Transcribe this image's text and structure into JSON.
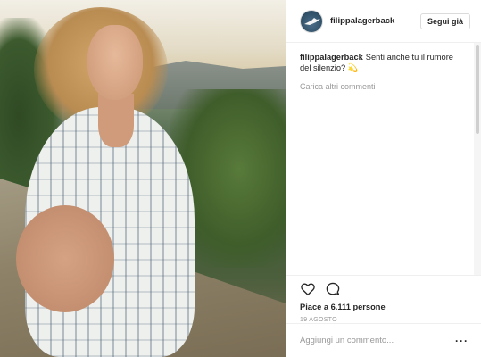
{
  "post": {
    "username": "filippalagerback",
    "follow_label": "Segui già",
    "caption_user": "filippalagerback",
    "caption_text": "Senti anche tu il rumore del silenzio? 💫",
    "load_more": "Carica altri commenti",
    "likes": "Piace a 6.111 persone",
    "date": "19 AGOSTO",
    "comment_placeholder": "Aggiungi un commento...",
    "more_label": "···"
  },
  "icons": [
    "heart-icon",
    "comment-icon",
    "more-icon"
  ],
  "colors": {
    "text": "#262626",
    "muted": "#999999",
    "border": "#efefef"
  }
}
